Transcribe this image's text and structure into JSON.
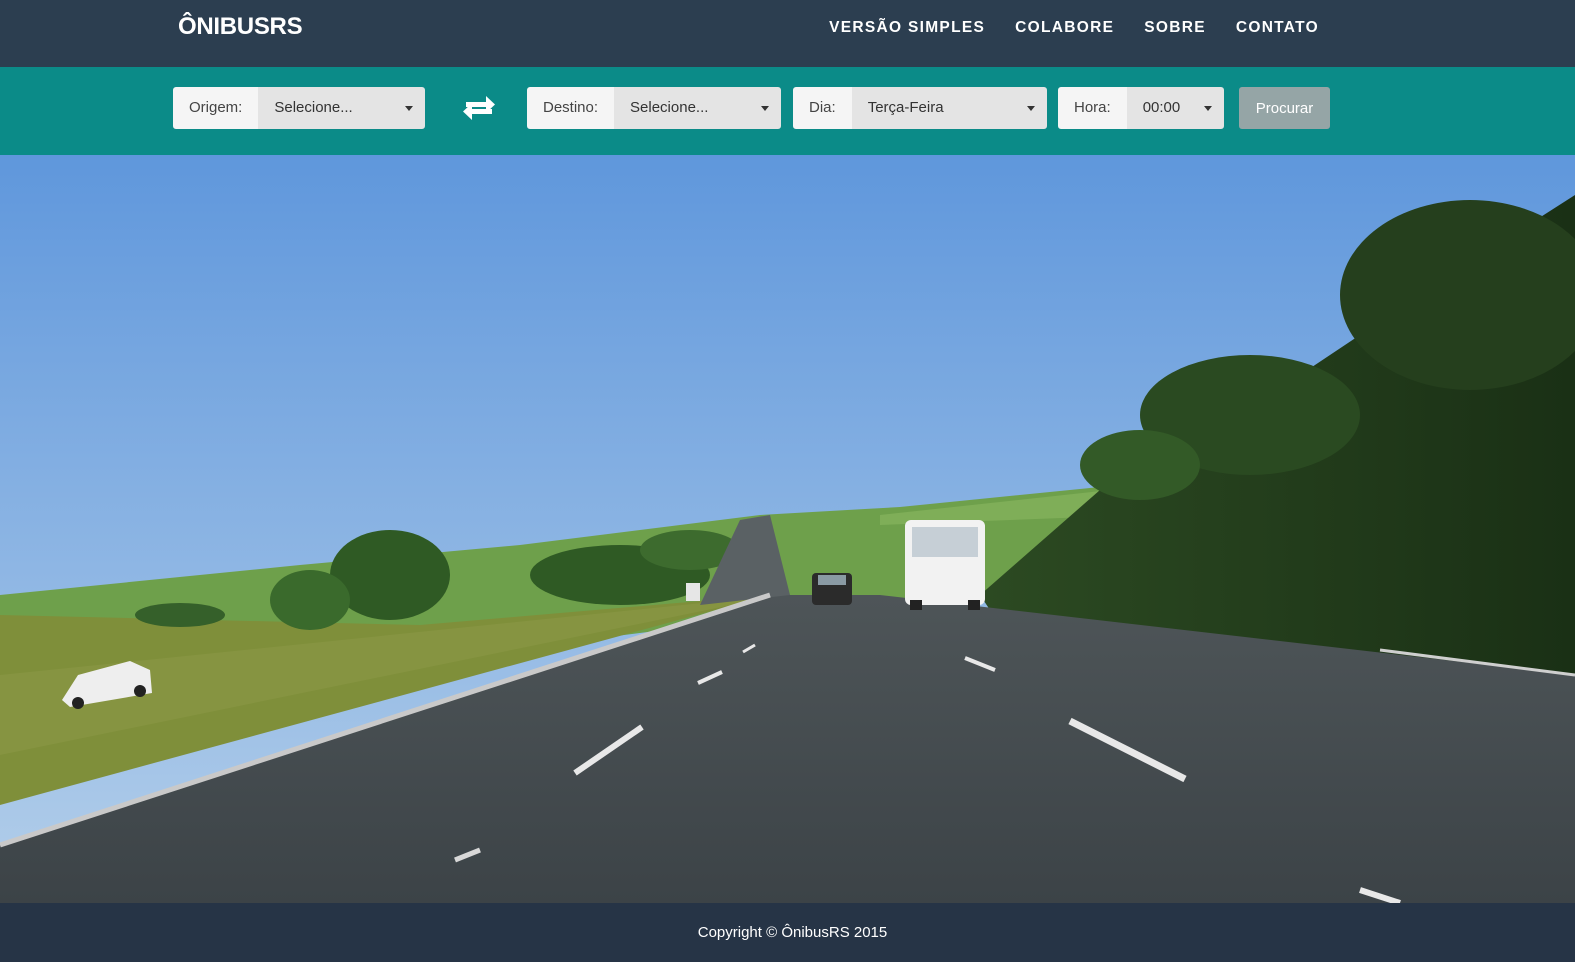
{
  "brand": "ÔNIBUSRS",
  "nav": {
    "simple": "VERSÃO SIMPLES",
    "collab": "COLABORE",
    "about": "SOBRE",
    "contact": "CONTATO"
  },
  "search": {
    "origin_label": "Origem:",
    "origin_value": "Selecione...",
    "destination_label": "Destino:",
    "destination_value": "Selecione...",
    "day_label": "Dia:",
    "day_value": "Terça-Feira",
    "hour_label": "Hora:",
    "hour_value": "00:00",
    "submit": "Procurar"
  },
  "icons": {
    "swap": "swap-arrows-icon",
    "caret": "caret-down-icon"
  },
  "colors": {
    "navbar": "#2c3e50",
    "searchbar": "#0b8b88",
    "button": "#95a5a6",
    "footer": "#263446"
  },
  "footer": {
    "copyright": "Copyright © ÔnibusRS 2015"
  }
}
